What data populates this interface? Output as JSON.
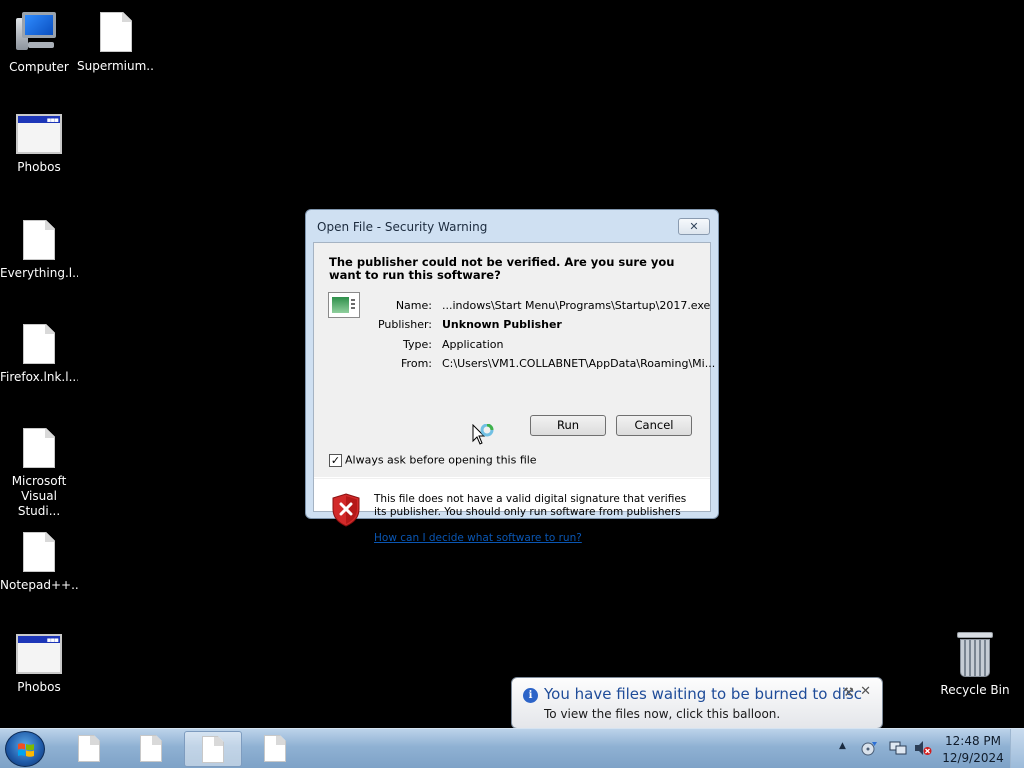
{
  "desktop": {
    "icons": [
      {
        "label": "Computer",
        "icon": "computer-icon"
      },
      {
        "label": "Supermium...",
        "icon": "document-icon"
      },
      {
        "label": "Phobos",
        "icon": "application-window-icon"
      },
      {
        "label": "Everything.l...",
        "icon": "document-icon"
      },
      {
        "label": "Firefox.lnk.l...",
        "icon": "document-icon"
      },
      {
        "label": "Microsoft\nVisual Studi...",
        "icon": "document-icon"
      },
      {
        "label": "Notepad++...",
        "icon": "document-icon"
      },
      {
        "label": "Phobos",
        "icon": "application-window-icon"
      },
      {
        "label": "Recycle Bin",
        "icon": "recycle-bin-icon"
      }
    ]
  },
  "dialog": {
    "title": "Open File - Security Warning",
    "close_glyph": "✕",
    "headline": "The publisher could not be verified.  Are you sure you want to run this software?",
    "fields": [
      {
        "key": "Name:",
        "value": "...indows\\Start Menu\\Programs\\Startup\\2017.exe"
      },
      {
        "key": "Publisher:",
        "value": "Unknown Publisher"
      },
      {
        "key": "Type:",
        "value": "Application"
      },
      {
        "key": "From:",
        "value": "C:\\Users\\VM1.COLLABNET\\AppData\\Roaming\\Mi..."
      }
    ],
    "run_label": "Run",
    "cancel_label": "Cancel",
    "checkbox_label": "Always ask before opening this file",
    "checkbox_checked": true,
    "checkbox_mark": "✓",
    "warning_text": "This file does not have a valid digital signature that verifies its publisher.  You should only run software from publishers you trust.",
    "warning_link": "How can I decide what software to run?"
  },
  "balloon": {
    "title": "You have files waiting to be burned to disc",
    "text": "To view the files now, click this balloon.",
    "info_glyph": "i",
    "close_glyph": "✕",
    "options_glyph": "⚒"
  },
  "taskbar": {
    "buttons": [
      {
        "icon": "document-icon",
        "active": false
      },
      {
        "icon": "document-icon",
        "active": false
      },
      {
        "icon": "document-icon",
        "active": true
      },
      {
        "icon": "document-icon",
        "active": false
      }
    ],
    "tray_arrow": "▲",
    "time": "12:48 PM",
    "date": "12/9/2024"
  },
  "colors": {
    "desktop_bg": "#000000",
    "dialog_frame": "#cfe0f2",
    "link": "#0a56b3",
    "balloon_title": "#1f4c99"
  }
}
